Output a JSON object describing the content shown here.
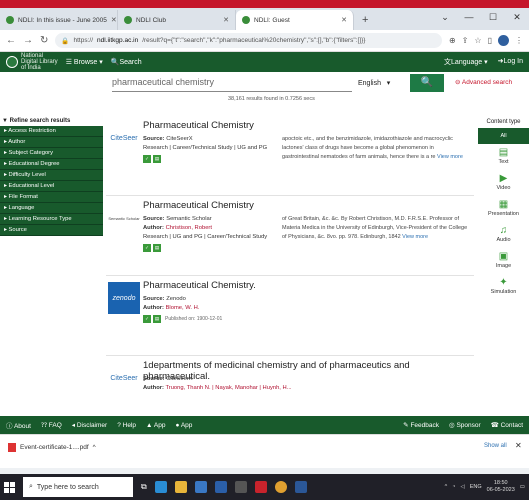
{
  "browser": {
    "tabs": [
      {
        "label": "NDLI: In this issue - June 2005"
      },
      {
        "label": "NDLI Club"
      },
      {
        "label": "NDLI: Guest"
      }
    ],
    "url_prefix": "https://",
    "url_domain": "ndl.iitkgp.ac.in",
    "url_rest": "/result?q={\"t\":\"search\",\"k\":\"pharmaceutical%20chemistry\",\"s\":[],\"b\":{\"filters\":[]}}"
  },
  "header": {
    "logo_line1": "National",
    "logo_line2": "Digital Library",
    "logo_line3": "of India",
    "browse": "Browse",
    "search": "Search",
    "language": "Language",
    "login": "Log In"
  },
  "search": {
    "query": "pharmaceutical chemistry",
    "language": "English",
    "advanced": "Advanced search",
    "results_count": "38,161 results found in 0.7256 secs"
  },
  "filters": {
    "heading": "Refine search results",
    "items": [
      "Access Restriction",
      "Author",
      "Subject Category",
      "Educational Degree",
      "Difficulty Level",
      "Educational Level",
      "File Format",
      "Language",
      "Learning Resource Type",
      "Source"
    ]
  },
  "results": [
    {
      "thumb": "CiteSeer",
      "title": "Pharmaceutical Chemistry",
      "source_label": "Source:",
      "source": "CiteSeerX",
      "tags": "Research | Career/Technical Study | UG and PG",
      "desc": "apoctoic etc., and the benzimidazole, imidazothiazole and macrocyclic lactones' class of drugs have become a global phenomenon in gastrointestinal nematodes of farm animals, hence there is a re",
      "more": "View more"
    },
    {
      "thumb": "Semantic Scholar",
      "title": "Pharmaceutical Chemistry",
      "source_label": "Source:",
      "source": "Semantic Scholar",
      "author_label": "Author:",
      "author": "Christison, Robert",
      "tags": "Research | UG and PG | Career/Technical Study",
      "desc": "of Great Britain, &c. &c. By Robert Christison, M.D. F.R.S.E. Professor of Materia Medica in the University of Edinburgh, Vice-President of the College of Physicians, &c. 8vo. pp. 978. Edinburgh, 1842",
      "more": "View more"
    },
    {
      "thumb": "zenodo",
      "title": "Pharmaceutical Chemistry.",
      "source_label": "Source:",
      "source": "Zenodo",
      "author_label": "Author:",
      "author": "Blome, W. H.",
      "published": "Published on: 1900-12-01"
    },
    {
      "thumb": "CiteSeer",
      "title": "1departments of medicinal chemistry and of pharmaceutics and pharmaceutical.",
      "source_label": "Source:",
      "source": "CiteSeerX",
      "author_label": "Author:",
      "author": "Truong, Thanh N. | Nayak, Manohar | Huynh, H..."
    }
  ],
  "content_type": {
    "heading": "Content type",
    "items": [
      "All",
      "Text",
      "Video",
      "Presentation",
      "Audio",
      "Image",
      "Simulation"
    ]
  },
  "footer": {
    "items": [
      "About",
      "FAQ",
      "Disclaimer",
      "Help",
      "App",
      "App"
    ],
    "right": [
      "Feedback",
      "Sponsor",
      "Contact"
    ]
  },
  "download": {
    "file": "Event-certificate-1....pdf",
    "show_all": "Show all"
  },
  "taskbar": {
    "search_placeholder": "Type here to search",
    "lang": "ENG",
    "time": "18:50",
    "date": "06-05-2023"
  }
}
